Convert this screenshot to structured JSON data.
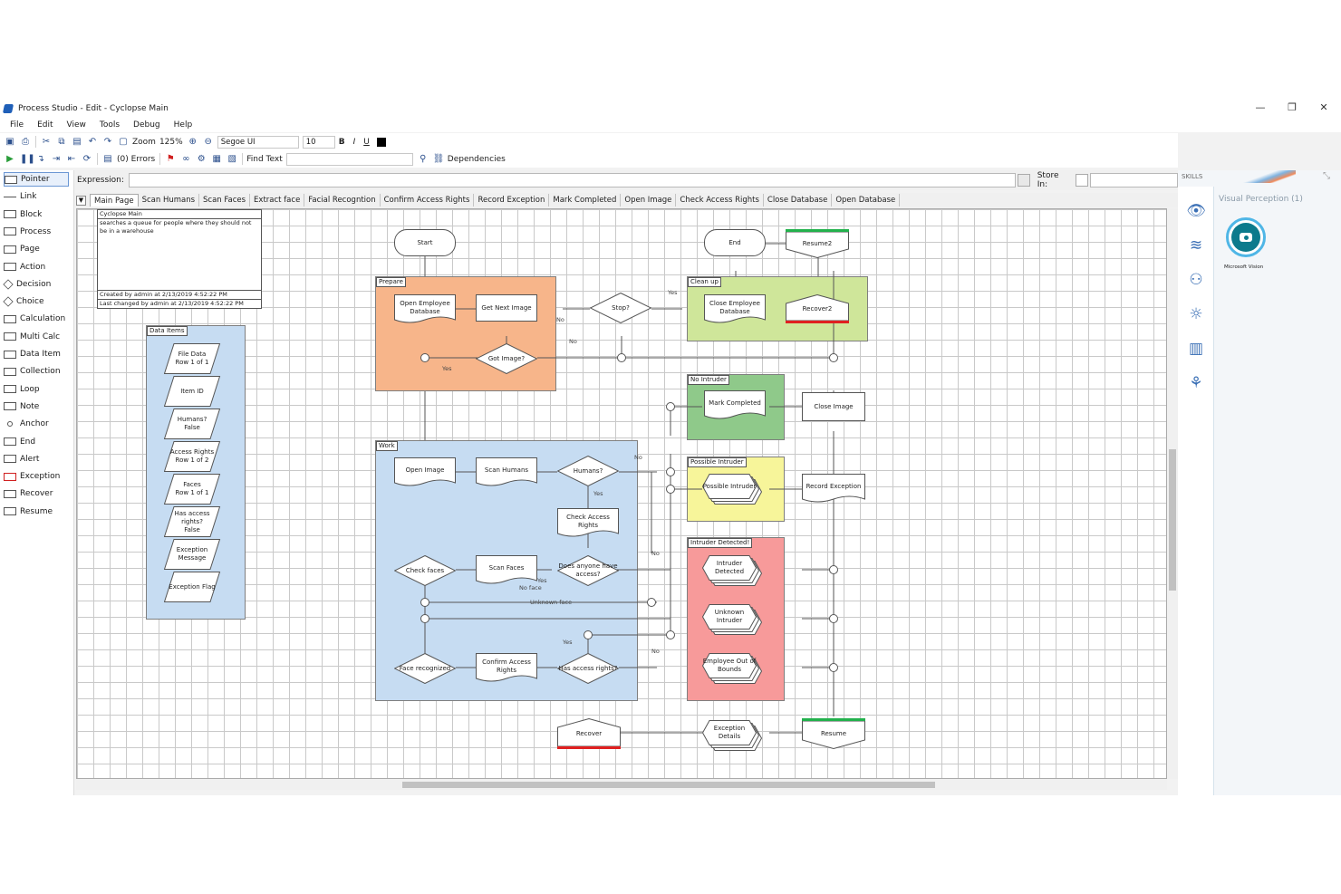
{
  "window": {
    "title": "Process Studio - Edit - Cyclopse Main",
    "min_glyph": "—",
    "max_glyph": "❐",
    "close_glyph": "✕"
  },
  "menu": [
    "File",
    "Edit",
    "View",
    "Tools",
    "Debug",
    "Help"
  ],
  "toolbar1": {
    "zoom_label": "Zoom",
    "zoom_value": "125%",
    "font": "Segoe UI",
    "font_size": "10",
    "bold": "B",
    "italic": "I",
    "underline": "U"
  },
  "toolbar2": {
    "errors": "(0) Errors",
    "find_text": "Find Text",
    "dependencies": "Dependencies"
  },
  "expression": {
    "label": "Expression:",
    "store_in_label": "Store In:"
  },
  "palette": [
    "Pointer",
    "Link",
    "Block",
    "Process",
    "Page",
    "Action",
    "Decision",
    "Choice",
    "Calculation",
    "Multi Calc",
    "Data Item",
    "Collection",
    "Loop",
    "Note",
    "Anchor",
    "End",
    "Alert",
    "Exception",
    "Recover",
    "Resume"
  ],
  "tabs": [
    "Main Page",
    "Scan Humans",
    "Scan Faces",
    "Extract face",
    "Facial Recogntion",
    "Confirm Access Rights",
    "Record Exception",
    "Mark Completed",
    "Open Image",
    "Check Access Rights",
    "Close Database",
    "Open Database"
  ],
  "skills": {
    "header": "SKILLS",
    "visual_perception": "Visual Perception (1)",
    "microsoft_vision": "Microsoft Vision"
  },
  "info_box": {
    "title": "Cyclopse Main",
    "description": "searches a queue for people where they should not be in a warehouse",
    "created": "Created by admin at 2/13/2019 4:52:22 PM",
    "changed": "Last changed by admin at 2/13/2019 4:52:22 PM"
  },
  "blocks": {
    "data_items": "Data Items",
    "prepare": "Prepare",
    "work": "Work",
    "clean_up": "Clean up",
    "no_intruder": "No Intruder",
    "possible_intruder": "Possible Intruder",
    "intruder_detected": "Intruder Detected!"
  },
  "data_items": [
    "File Data\nRow 1 of 1",
    "Item ID",
    "Humans?\nFalse",
    "Access Rights\nRow 1 of 2",
    "Faces\nRow 1 of 1",
    "Has access rights?\nFalse",
    "Exception Message",
    "Exception Flag"
  ],
  "stages": {
    "start": "Start",
    "end": "End",
    "resume2": "Resume2",
    "open_employee_db": "Open Employee Database",
    "get_next_image": "Get Next Image",
    "stop": "Stop?",
    "got_image": "Got Image?",
    "close_employee_db": "Close Employee Database",
    "recover2": "Recover2",
    "mark_completed": "Mark Completed",
    "close_image": "Close Image",
    "open_image": "Open Image",
    "scan_humans": "Scan Humans",
    "humans": "Humans?",
    "check_access_rights": "Check Access Rights",
    "possible_intruder": "Possible Intruder",
    "record_exception": "Record Exception",
    "check_faces": "Check faces",
    "scan_faces": "Scan Faces",
    "does_anyone_have_access": "Does anyone have access?",
    "intruder_detected": "Intruder Detected",
    "unknown_intruder": "Unknown Intruder",
    "face_recognized": "Face recognized",
    "confirm_access_rights": "Confirm Access Rights",
    "has_access_rights": "Has access rights?",
    "employee_out_of_bounds": "Employee Out of Bounds",
    "recover": "Recover",
    "exception_details": "Exception Details",
    "resume": "Resume"
  },
  "wire_labels": {
    "yes": "Yes",
    "no": "No",
    "no_face": "No face",
    "unknown_face": "Unknown face"
  },
  "colors": {
    "prepare": "#f7b58a",
    "work": "#c6dcf2",
    "clean_up": "#cfe69a",
    "no_intruder": "#8fc98a",
    "possible_intruder": "#f7f59a",
    "intruder_detected": "#f79a9a",
    "data_items": "#c6dcf2",
    "recover_bar": "#e02020",
    "resume_bar": "#22b14c",
    "accent": "#2a7fd4"
  }
}
